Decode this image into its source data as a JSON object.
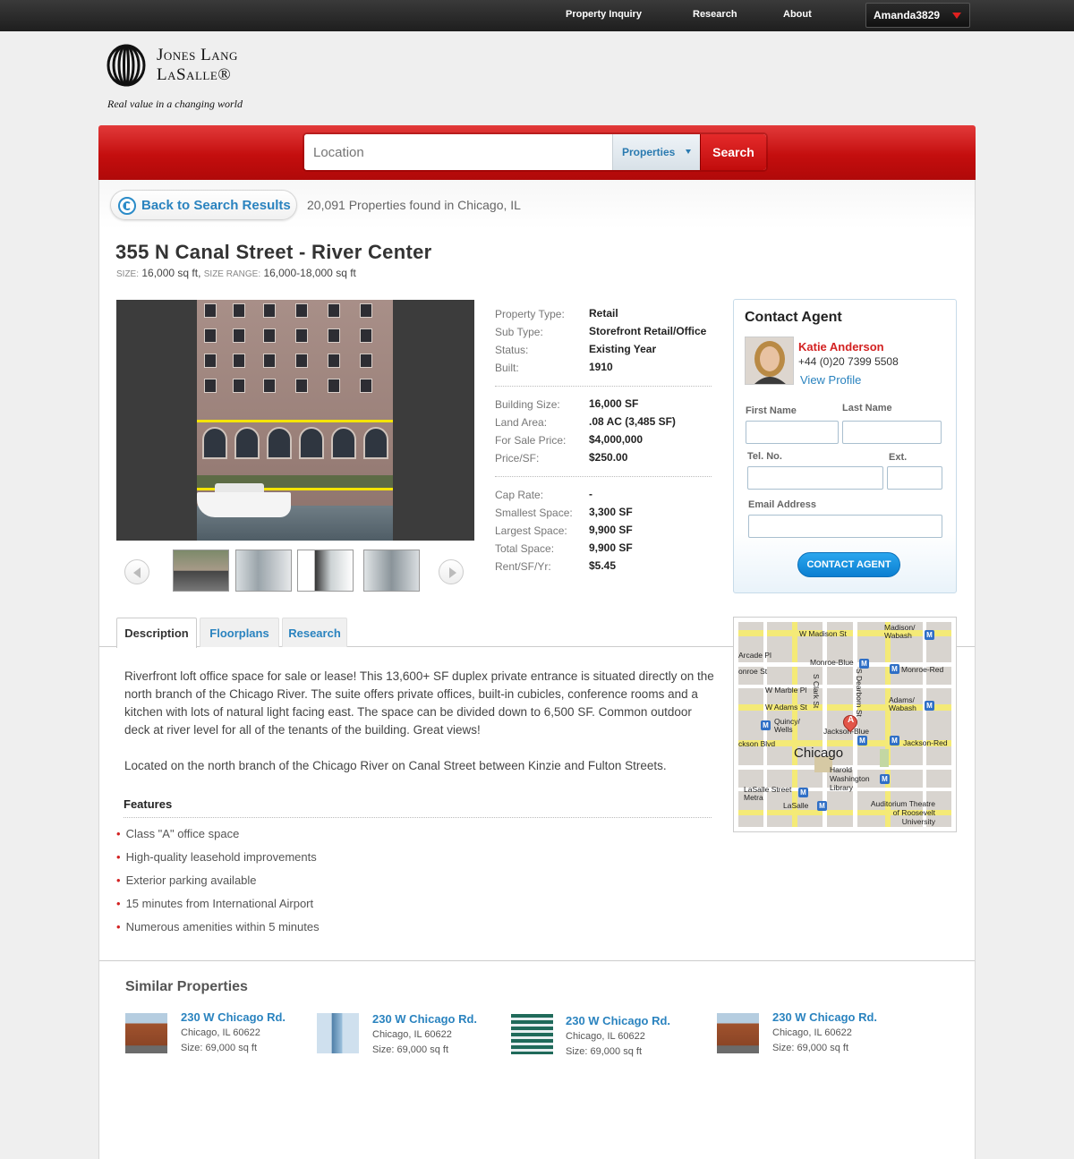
{
  "topnav": {
    "items": [
      "Property Inquiry",
      "Research",
      "About"
    ],
    "user": "Amanda3829"
  },
  "logo": {
    "line1": "Jones Lang",
    "line2": "LaSalle®",
    "tagline": "Real value in a changing world"
  },
  "search": {
    "placeholder": "Location",
    "type_value": "Properties",
    "button": "Search"
  },
  "results": {
    "back_label": "Back to Search Results",
    "found_text": "20,091 Properties found in Chicago, IL"
  },
  "property": {
    "title": "355 N Canal Street - River Center",
    "size_label": "SIZE:",
    "size_value": "16,000 sq ft,",
    "range_label": "SIZE RANGE:",
    "range_value": "16,000-18,000 sq ft",
    "details_groups": [
      [
        {
          "k": "Property Type:",
          "v": "Retail"
        },
        {
          "k": "Sub Type:",
          "v": "Storefront Retail/Office"
        },
        {
          "k": "Status:",
          "v": "Existing Year"
        },
        {
          "k": "Built:",
          "v": "1910"
        }
      ],
      [
        {
          "k": "Building Size:",
          "v": "16,000 SF"
        },
        {
          "k": "Land Area:",
          "v": ".08 AC (3,485 SF)"
        },
        {
          "k": "For Sale Price:",
          "v": "$4,000,000"
        },
        {
          "k": "Price/SF:",
          "v": "$250.00"
        }
      ],
      [
        {
          "k": "Cap Rate:",
          "v": "-"
        },
        {
          "k": "Smallest Space:",
          "v": "3,300 SF"
        },
        {
          "k": "Largest Space:",
          "v": "9,900 SF"
        },
        {
          "k": "Total Space:",
          "v": "9,900 SF"
        },
        {
          "k": "Rent/SF/Yr:",
          "v": "$5.45"
        }
      ]
    ]
  },
  "contact": {
    "heading": "Contact Agent",
    "agent_name": "Katie Anderson",
    "agent_phone": "+44 (0)20 7399 5508",
    "view_profile": "View Profile",
    "first_name": "First Name",
    "last_name": "Last Name",
    "tel": "Tel. No.",
    "ext": "Ext.",
    "email": "Email Address",
    "button": "CONTACT AGENT"
  },
  "tabs": [
    "Description",
    "Floorplans",
    "Research"
  ],
  "description": {
    "p1": "Riverfront loft office space for sale or lease! This 13,600+ SF duplex private entrance is situated directly on the north branch of the Chicago River. The suite offers private offices, built-in cubicles, conference rooms and a kitchen with lots of natural light facing east. The space can be divided down to 6,500 SF. Common outdoor deck at river level for all of the tenants of the building. Great views!",
    "p2": "Located on the north branch of the Chicago River on Canal Street between Kinzie and Fulton Streets.",
    "features_heading": "Features",
    "features": [
      "Class \"A\" office space",
      "High-quality leasehold improvements",
      "Exterior parking available",
      "15 minutes from International Airport",
      "Numerous amenities within 5 minutes"
    ]
  },
  "map": {
    "labels": [
      "W Madison St",
      "Madison/ Wabash",
      "Arcade Pl",
      "Monroe-Blue",
      "Monroe-Red",
      "onroe St",
      "W Marble Pl",
      "W Adams St",
      "Adams/ Wabash",
      "Quincy/ Wells",
      "Jackson-Blue",
      "ckson Blvd",
      "Jackson-Red",
      "Chicago",
      "Harold Washington Library",
      "LaSalle Street Metra",
      "LaSalle",
      "Auditorium Theatre of Roosevelt University",
      "S Clark St",
      "S Dearborn St"
    ],
    "marker": "A"
  },
  "similar": {
    "heading": "Similar Properties",
    "items": [
      {
        "title": "230 W Chicago Rd.",
        "city": "Chicago, IL 60622",
        "size": "Size: 69,000 sq ft"
      },
      {
        "title": "230 W Chicago Rd.",
        "city": "Chicago, IL 60622",
        "size": "Size: 69,000 sq ft"
      },
      {
        "title": "230 W Chicago Rd.",
        "city": "Chicago, IL 60622",
        "size": "Size: 69,000 sq ft"
      },
      {
        "title": "230 W Chicago Rd.",
        "city": "Chicago, IL 60622",
        "size": "Size: 69,000 sq ft"
      }
    ]
  },
  "colors": {
    "brand_red": "#c40e0e",
    "link_blue": "#2a83bf",
    "button_blue": "#0b7fd1"
  }
}
